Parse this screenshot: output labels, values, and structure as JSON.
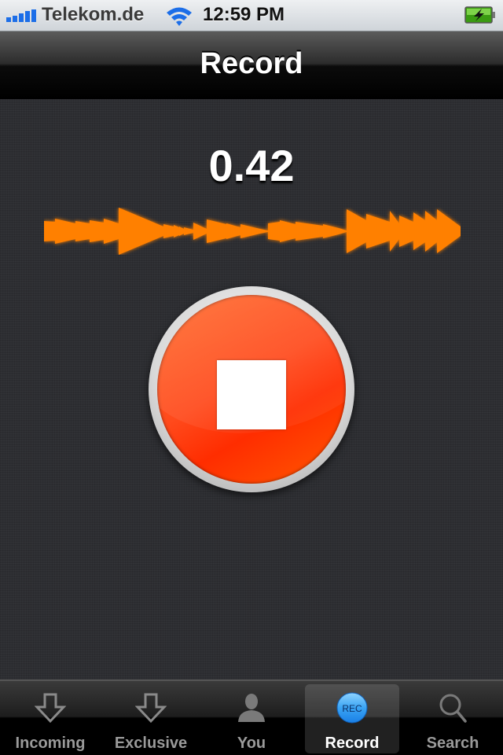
{
  "status_bar": {
    "carrier": "Telekom.de",
    "time": "12:59 PM",
    "signal_icon": "signal-bars-icon",
    "wifi_icon": "wifi-icon",
    "battery_icon": "battery-charging-icon",
    "signal_bars": 5
  },
  "nav_bar": {
    "title": "Record"
  },
  "recorder": {
    "elapsed": "0.42",
    "waveform_color": "#ff8000",
    "stop_button_icon": "stop-icon",
    "stop_button_color": "#ff3c10"
  },
  "tab_bar": {
    "active_index": 3,
    "items": [
      {
        "label": "Incoming",
        "icon": "download-arrow-icon"
      },
      {
        "label": "Exclusive",
        "icon": "download-arrow-icon"
      },
      {
        "label": "You",
        "icon": "person-icon"
      },
      {
        "label": "Record",
        "icon": "rec-badge-icon",
        "badge_text": "REC"
      },
      {
        "label": "Search",
        "icon": "search-icon"
      }
    ]
  }
}
